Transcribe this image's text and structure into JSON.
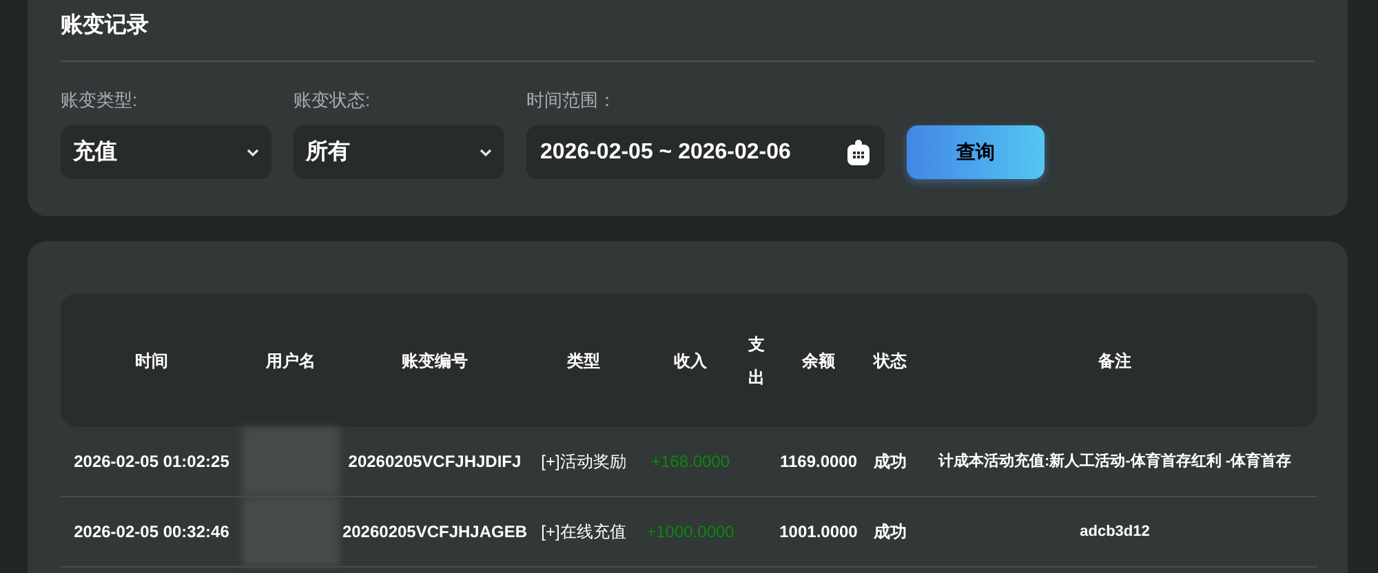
{
  "title": "账变记录",
  "filters": [
    {
      "kind": "select",
      "label": "账变类型:",
      "value": "充值"
    },
    {
      "kind": "select",
      "label": "账变状态:",
      "value": "所有"
    },
    {
      "kind": "date",
      "label": "时间范围：",
      "value": "2026-02-05 ~ 2026-02-06"
    }
  ],
  "query_button": "查询",
  "table": {
    "columns": [
      "时间",
      "用户名",
      "账变编号",
      "类型",
      "收入",
      "支出",
      "余额",
      "状态",
      "备注"
    ],
    "rows": [
      {
        "time": "2026-02-05 01:02:25",
        "number": "20260205VCFJHJDIFJ",
        "type": "[+]活动奖励",
        "income": "+168.0000",
        "balance": "1169.0000",
        "status": "成功",
        "remark": "计成本活动充值:新人工活动-体育首存红利 -体育首存"
      },
      {
        "time": "2026-02-05 00:32:46",
        "number": "20260205VCFJHJAGEB",
        "type": "[+]在线充值",
        "income": "+1000.0000",
        "balance": "1001.0000",
        "status": "成功",
        "remark": "adcb3d12"
      }
    ]
  }
}
